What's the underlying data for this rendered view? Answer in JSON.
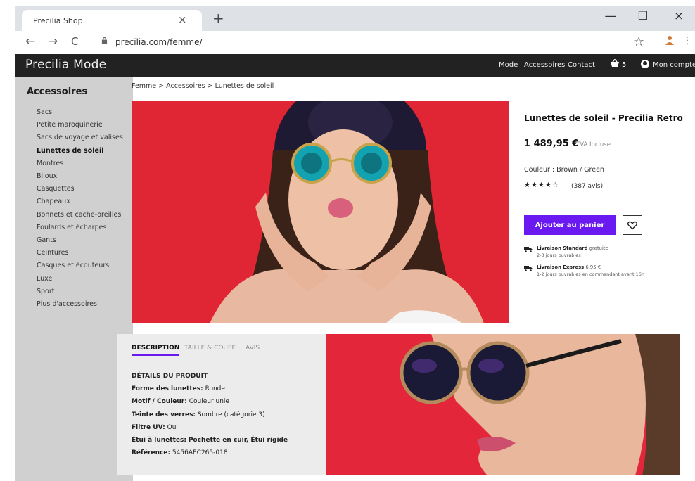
{
  "browser": {
    "tab_title": "Precilia Shop",
    "tab_close": "×",
    "new_tab": "+",
    "url": "precilia.com/femme/",
    "back": "←",
    "forward": "→",
    "reload": "C",
    "star": "☆",
    "menu": "⋮",
    "minimize": "—",
    "maximize": "☐",
    "close": "×"
  },
  "header": {
    "brand": "Precilia Mode",
    "nav": [
      "Mode",
      "Accessoires",
      "Contact"
    ],
    "cart_count": "5",
    "account_label": "Mon compte"
  },
  "sidebar": {
    "title": "Accessoires",
    "items": [
      {
        "label": "Sacs"
      },
      {
        "label": "Petite maroquinerie"
      },
      {
        "label": "Sacs de voyage et valises"
      },
      {
        "label": "Lunettes de soleil",
        "active": true
      },
      {
        "label": "Montres"
      },
      {
        "label": "Bijoux"
      },
      {
        "label": "Casquettes"
      },
      {
        "label": "Chapeaux"
      },
      {
        "label": "Bonnets et cache-oreilles"
      },
      {
        "label": "Foulards et écharpes"
      },
      {
        "label": "Gants"
      },
      {
        "label": "Ceintures"
      },
      {
        "label": "Casques et écouteurs"
      },
      {
        "label": "Luxe"
      },
      {
        "label": "Sport"
      },
      {
        "label": "Plus d'accessoires"
      }
    ]
  },
  "breadcrumb": "Femme > Accessoires > Lunettes de soleil",
  "product": {
    "title": "Lunettes de soleil - Precilia Retro",
    "price": "1 489,95 €",
    "tva": "TVA Incluse",
    "color": "Couleur : Brown / Green",
    "stars": "★★★★☆",
    "reviews": "(387 avis)",
    "add_to_cart": "Ajouter au panier",
    "shipping": [
      {
        "name": "Livraison Standard",
        "price": "gratuite",
        "delay": "2-3 jours ouvrables"
      },
      {
        "name": "Livraison Express",
        "price": "6,95 €",
        "delay": "1-2 jours ouvrables en commandant avant 16h"
      }
    ]
  },
  "tabs": [
    "DESCRIPTION",
    "TAILLE & COUPE",
    "AVIS"
  ],
  "details": {
    "heading": "DÉTAILS DU PRODUIT",
    "rows": [
      {
        "label": "Forme des lunettes:",
        "value": "Ronde"
      },
      {
        "label": "Motif / Couleur:",
        "value": "Couleur unie"
      },
      {
        "label": "Teinte des verres:",
        "value": "Sombre (catégorie 3)"
      },
      {
        "label": "Filtre UV:",
        "value": "Oui"
      },
      {
        "label": "Étui à lunettes:",
        "value": "Pochette en cuir, Étui rigide"
      },
      {
        "label": "Référence:",
        "value": "5456AEC265-018"
      }
    ]
  },
  "colors": {
    "accent": "#6a19f0",
    "header_bg": "#222222",
    "sidebar_bg": "#d0d0d0",
    "photo_bg": "#e02535"
  }
}
